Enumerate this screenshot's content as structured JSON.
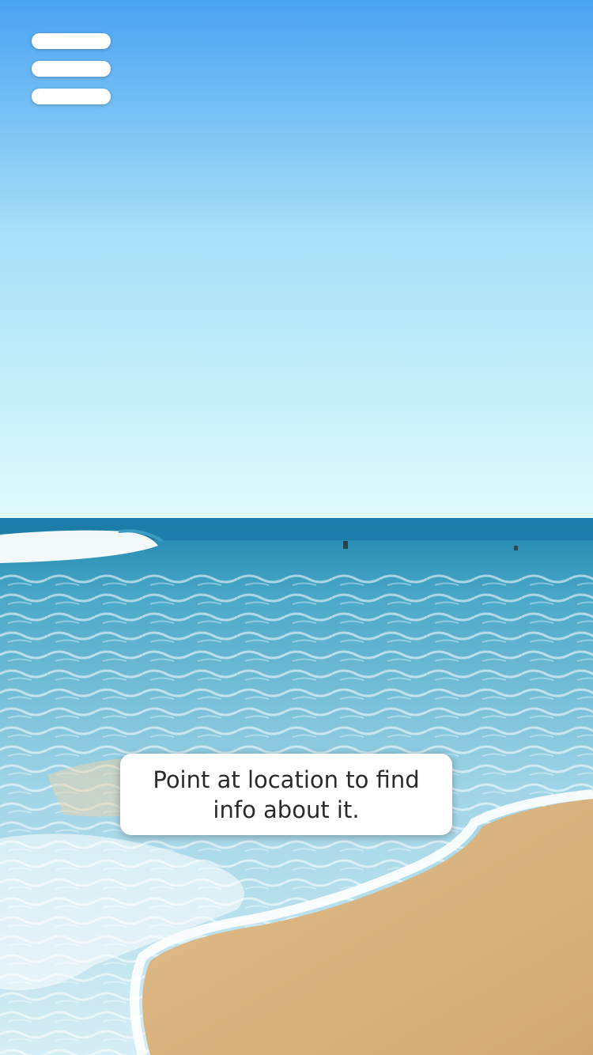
{
  "menu": {
    "icon": "hamburger-menu-icon",
    "color": "#ffffff"
  },
  "hint": {
    "text": "Point at location to find info about it."
  },
  "camera_view": {
    "scene": "beach",
    "colors": {
      "sky_top": "#4aa3f2",
      "sky_horizon": "#e0fbfc",
      "sea_deep": "#1f84ad",
      "surf": "#f4fbff",
      "sand": "#d8b27e"
    }
  }
}
